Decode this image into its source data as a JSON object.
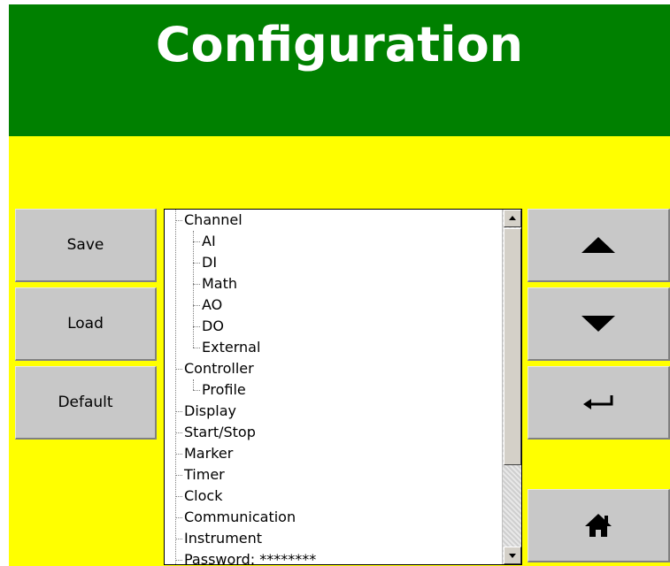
{
  "header": {
    "title": "Configuration",
    "background": "#008000",
    "text_color": "#ffffff"
  },
  "colors": {
    "screen_bg": "#ffff00",
    "button_bg": "#c8c8c8"
  },
  "left_buttons": {
    "save_label": "Save",
    "load_label": "Load",
    "default_label": "Default"
  },
  "right_buttons": {
    "up_icon": "arrow-up-icon",
    "down_icon": "arrow-down-icon",
    "enter_icon": "enter-icon",
    "home_icon": "home-icon"
  },
  "tree": {
    "items": [
      {
        "label": "Channel",
        "level": 0
      },
      {
        "label": "AI",
        "level": 1
      },
      {
        "label": "DI",
        "level": 1
      },
      {
        "label": "Math",
        "level": 1
      },
      {
        "label": "AO",
        "level": 1
      },
      {
        "label": "DO",
        "level": 1
      },
      {
        "label": "External",
        "level": 1
      },
      {
        "label": "Controller",
        "level": 0
      },
      {
        "label": "Profile",
        "level": 1
      },
      {
        "label": "Display",
        "level": 0
      },
      {
        "label": "Start/Stop",
        "level": 0
      },
      {
        "label": "Marker",
        "level": 0
      },
      {
        "label": "Timer",
        "level": 0
      },
      {
        "label": "Clock",
        "level": 0
      },
      {
        "label": "Communication",
        "level": 0
      },
      {
        "label": "Instrument",
        "level": 0
      },
      {
        "label": "Password: ********",
        "level": 0
      }
    ]
  }
}
